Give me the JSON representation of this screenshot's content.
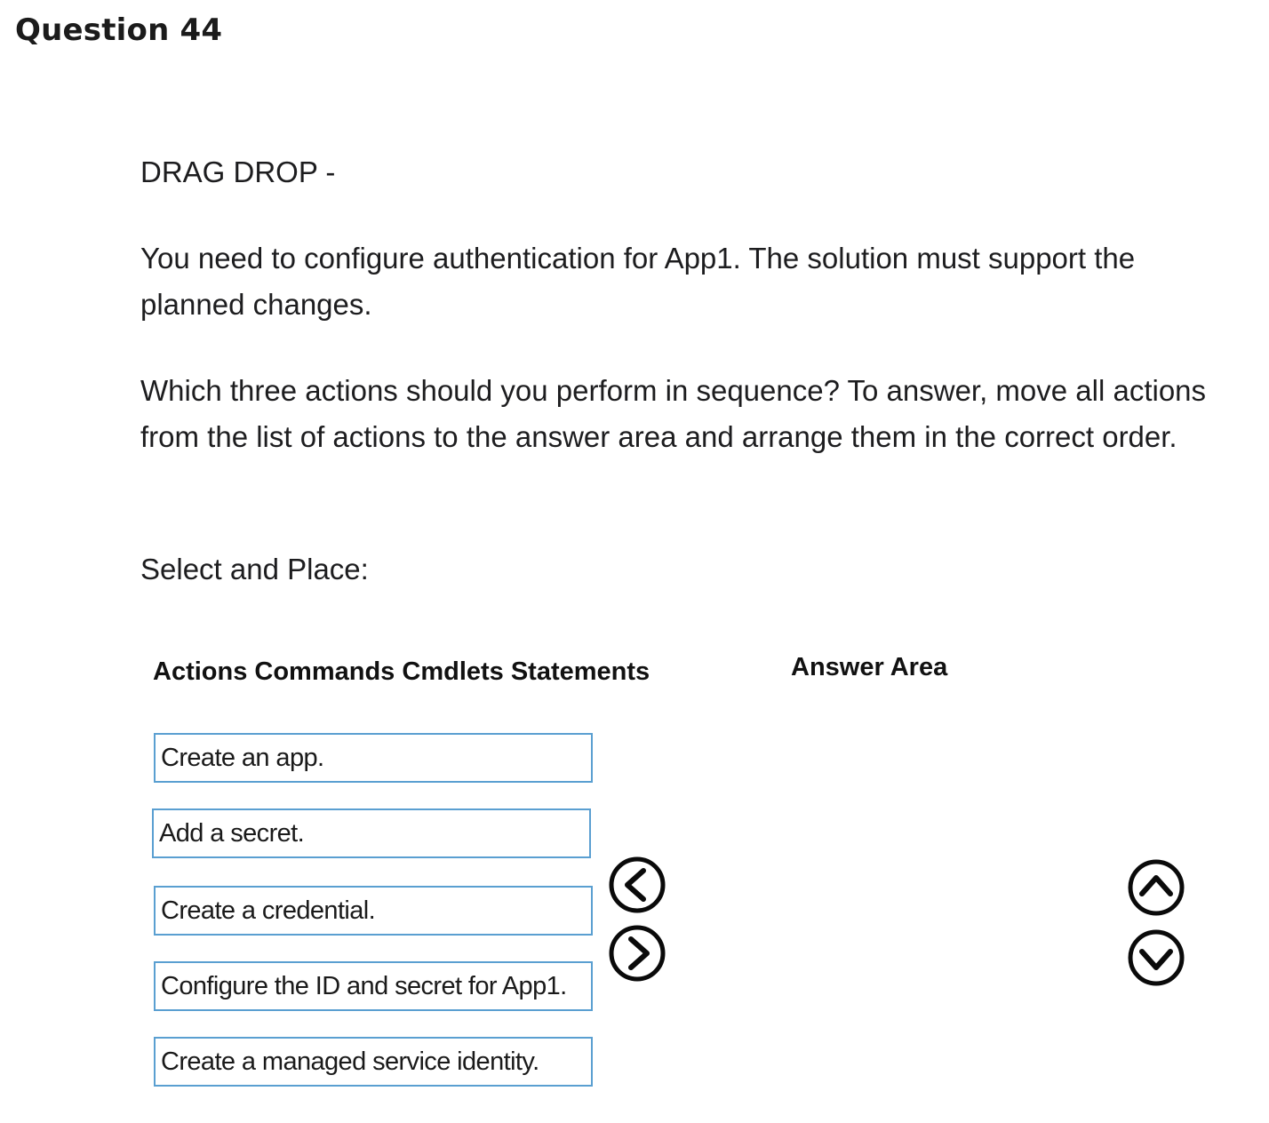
{
  "question": {
    "title": "Question 44"
  },
  "prompt": {
    "type_label": "DRAG DROP -",
    "scenario": "You need to configure authentication for App1. The solution must support the planned changes.",
    "instructions": "Which three actions should you perform in sequence? To answer, move all actions from the list of actions to the answer area and arrange them in the correct order.",
    "select_label": "Select and Place:"
  },
  "actions_panel": {
    "heading": "Actions Commands Cmdlets Statements",
    "items": [
      {
        "label": "Create an app."
      },
      {
        "label": "Add a secret."
      },
      {
        "label": "Create a credential."
      },
      {
        "label": "Configure the ID and secret for App1."
      },
      {
        "label": "Create a managed service identity."
      }
    ]
  },
  "answer_panel": {
    "heading": "Answer Area",
    "items": []
  },
  "controls": {
    "move_left_icon": "chevron-left-circle",
    "move_right_icon": "chevron-right-circle",
    "move_up_icon": "chevron-up-circle",
    "move_down_icon": "chevron-down-circle"
  }
}
